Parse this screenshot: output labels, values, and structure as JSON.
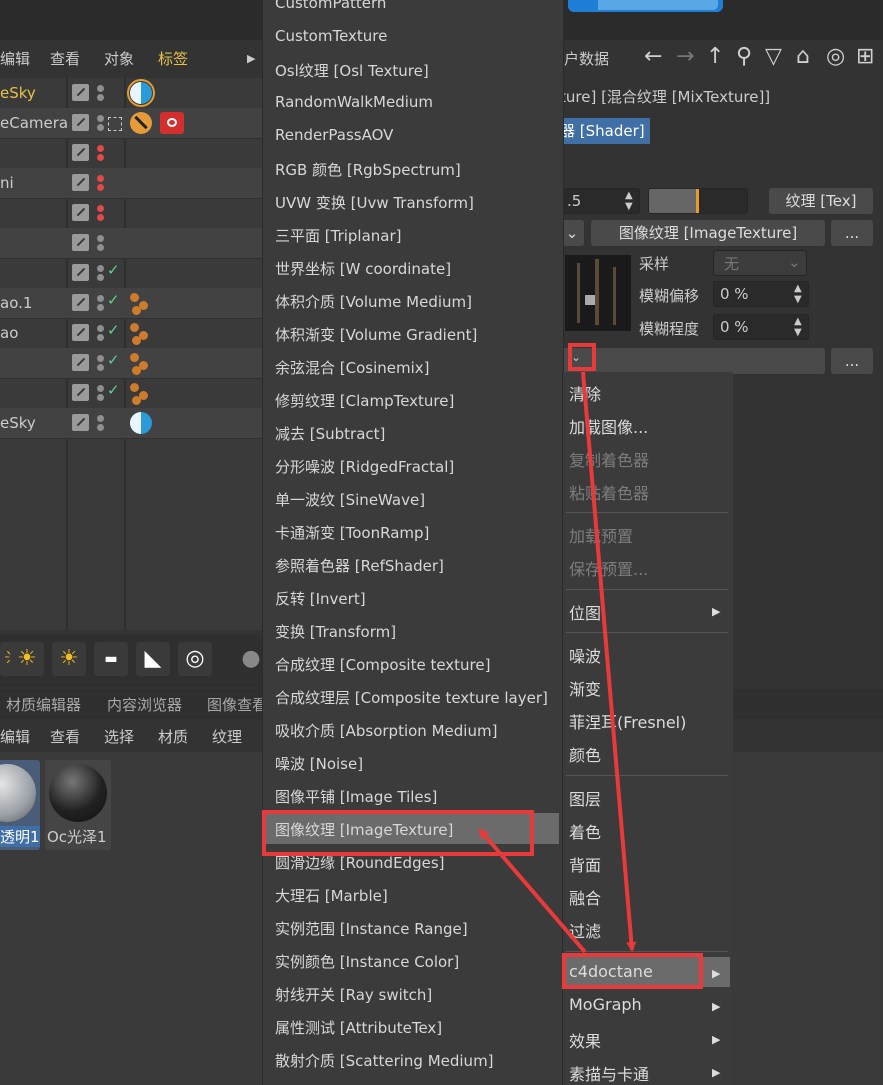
{
  "object_manager": {
    "menu": [
      "编辑",
      "查看",
      "对象",
      "标签"
    ],
    "rows": [
      {
        "name": "eSky"
      },
      {
        "name": "eCamera"
      },
      {
        "name": ""
      },
      {
        "name": "ni"
      },
      {
        "name": ""
      },
      {
        "name": ""
      },
      {
        "name": ""
      },
      {
        "name": "ao.1"
      },
      {
        "name": "ao"
      },
      {
        "name": ""
      },
      {
        "name": ""
      },
      {
        "name": "eSky"
      }
    ]
  },
  "material_panel": {
    "tabs": [
      "材质编辑器",
      "内容浏览器",
      "图像查看"
    ],
    "menu": [
      "编辑",
      "查看",
      "选择",
      "材质",
      "纹理"
    ],
    "materials": [
      {
        "label": "透明1"
      },
      {
        "label": "Oc光泽1"
      }
    ]
  },
  "attribute_manager": {
    "menu_partial": "户数据",
    "breadcrumb": "ture] [混合纹理 [MixTexture]]",
    "shader_button": "器 [Shader]",
    "value_field": ".5",
    "texture_button": "纹理 [Tex]",
    "image_texture_button": "图像纹理 [ImageTexture]",
    "more_button": "...",
    "sampling_label": "采样",
    "sampling_value": "无",
    "blur_offset_label": "模糊偏移",
    "blur_offset_value": "0 %",
    "blur_amount_label": "模糊程度",
    "blur_amount_value": "0 %"
  },
  "shader_list": {
    "items": [
      "CustomPattern",
      "CustomTexture",
      "Osl纹理 [Osl Texture]",
      "RandomWalkMedium",
      "RenderPassAOV",
      "RGB 颜色 [RgbSpectrum]",
      "UVW 变换 [Uvw Transform]",
      "三平面 [Triplanar]",
      "世界坐标 [W coordinate]",
      "体积介质 [Volume Medium]",
      "体积渐变 [Volume Gradient]",
      "余弦混合 [Cosinemix]",
      "修剪纹理 [ClampTexture]",
      "减去 [Subtract]",
      "分形噪波 [RidgedFractal]",
      "单一波纹 [SineWave]",
      "卡通渐变 [ToonRamp]",
      "参照着色器 [RefShader]",
      "反转 [Invert]",
      "变换 [Transform]",
      "合成纹理 [Composite texture]",
      "合成纹理层 [Composite texture layer]",
      "吸收介质 [Absorption Medium]",
      "噪波 [Noise]",
      "图像平铺 [Image Tiles]",
      "图像纹理 [ImageTexture]",
      "圆滑边缘 [RoundEdges]",
      "大理石 [Marble]",
      "实例范围 [Instance Range]",
      "实例颜色 [Instance Color]",
      "射线开关 [Ray switch]",
      "属性测试 [AttributeTex]",
      "散射介质 [Scattering Medium]"
    ],
    "highlighted": "图像纹理 [ImageTexture]"
  },
  "context_menu": {
    "items": [
      {
        "label": "清除",
        "disabled": false
      },
      {
        "label": "加载图像...",
        "disabled": false
      },
      {
        "label": "复制着色器",
        "disabled": true
      },
      {
        "label": "粘贴着色器",
        "disabled": true
      },
      {
        "label": "加载预置",
        "disabled": true
      },
      {
        "label": "保存预置...",
        "disabled": true
      },
      {
        "label": "位图",
        "disabled": false,
        "submenu": true
      },
      {
        "label": "噪波",
        "disabled": false
      },
      {
        "label": "渐变",
        "disabled": false
      },
      {
        "label": "菲涅耳(Fresnel)",
        "disabled": false
      },
      {
        "label": "颜色",
        "disabled": false
      },
      {
        "label": "图层",
        "disabled": false
      },
      {
        "label": "着色",
        "disabled": false
      },
      {
        "label": "背面",
        "disabled": false
      },
      {
        "label": "融合",
        "disabled": false
      },
      {
        "label": "过滤",
        "disabled": false
      },
      {
        "label": "c4doctane",
        "disabled": false,
        "submenu": true,
        "highlighted": true
      },
      {
        "label": "MoGraph",
        "disabled": false,
        "submenu": true
      },
      {
        "label": "效果",
        "disabled": false,
        "submenu": true
      },
      {
        "label": "素描与卡通",
        "disabled": false,
        "submenu": true
      }
    ]
  },
  "colors": {
    "highlight_box": "#e83a3a",
    "menu_highlight": "#6b6b6b",
    "accent_orange": "#e79b2a",
    "tag_active": "#f0c020"
  }
}
